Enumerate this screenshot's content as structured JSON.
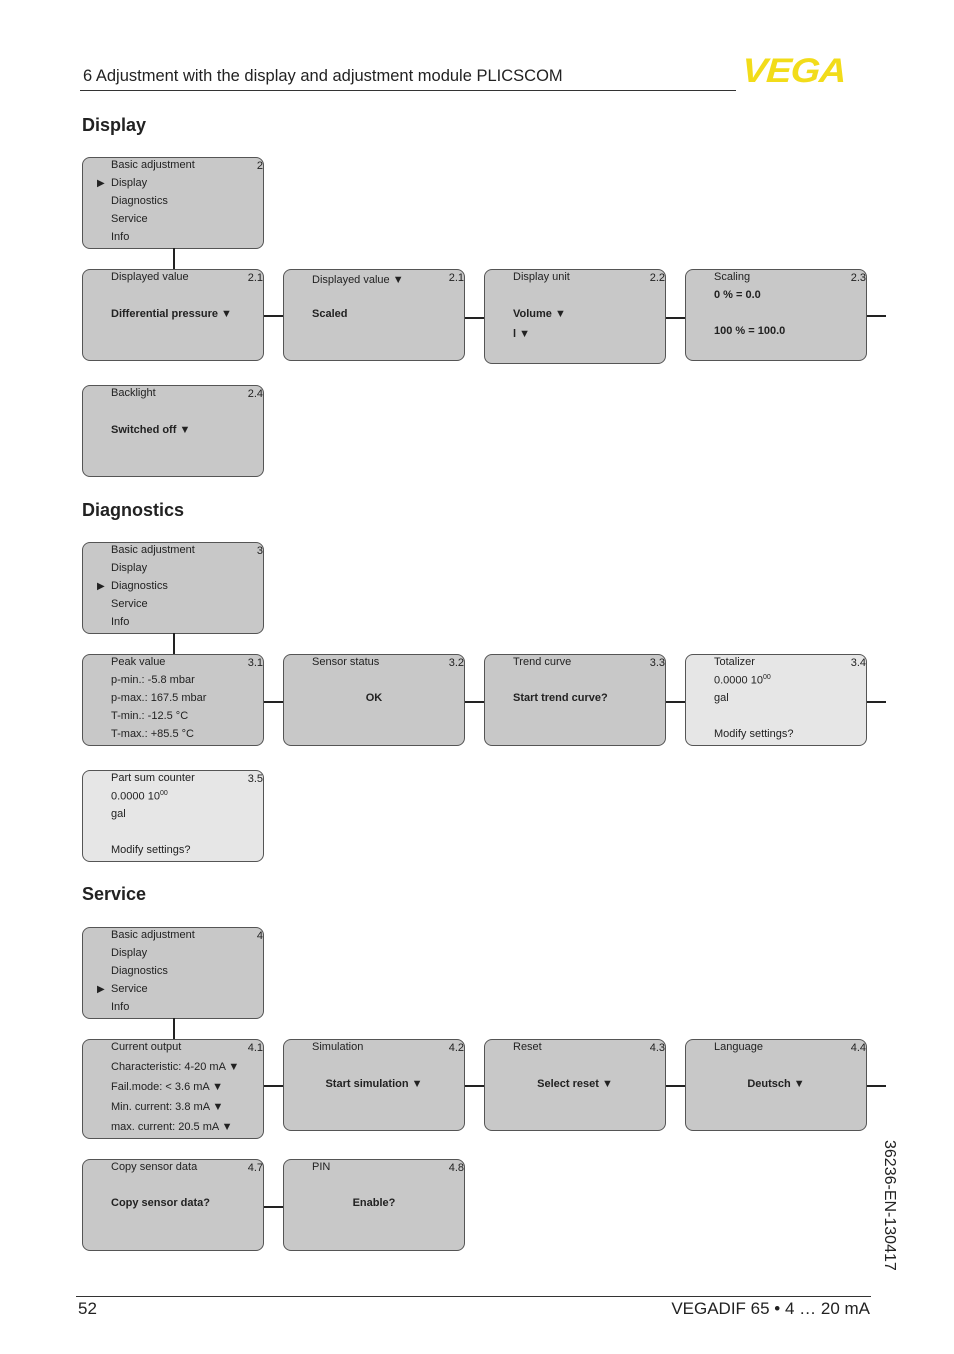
{
  "header": {
    "title": "6 Adjustment with the display and adjustment module PLICSCOM",
    "logo": "VEGA",
    "logo_color": "#f2dc1a"
  },
  "sections": {
    "display": "Display",
    "diagnostics": "Diagnostics",
    "service": "Service"
  },
  "menu": {
    "items": [
      "Basic adjustment",
      "Display",
      "Diagnostics",
      "Service",
      "Info"
    ],
    "pointer": "▶"
  },
  "display": {
    "menu_num": "2",
    "displayed_value": {
      "title": "Displayed value",
      "num": "2.1",
      "value": "Differential pressure ▼"
    },
    "displayed_value_scaled": {
      "title": "Displayed value ▼",
      "num": "2.1",
      "value": "Scaled"
    },
    "display_unit": {
      "title": "Display unit",
      "num": "2.2",
      "value1": "Volume ▼",
      "value2": "l ▼"
    },
    "scaling": {
      "title": "Scaling",
      "num": "2.3",
      "value1": "0 % = 0.0",
      "value2": "100 % = 100.0"
    },
    "backlight": {
      "title": "Backlight",
      "num": "2.4",
      "value": "Switched off ▼"
    }
  },
  "diagnostics": {
    "menu_num": "3",
    "peak": {
      "title": "Peak value",
      "num": "3.1",
      "lines": [
        "p-min.: -5.8 mbar",
        "p-max.: 167.5 mbar",
        "T-min.: -12.5 °C",
        "T-max.: +85.5 °C"
      ]
    },
    "sensor_status": {
      "title": "Sensor status",
      "num": "3.2",
      "value": "OK"
    },
    "trend": {
      "title": "Trend curve",
      "num": "3.3",
      "value": "Start trend curve?"
    },
    "totalizer": {
      "title": "Totalizer",
      "num": "3.4",
      "value": "0.0000 10",
      "exp": "00",
      "unit": "gal",
      "action": "Modify settings?"
    },
    "part_sum": {
      "title": "Part sum counter",
      "num": "3.5",
      "value": "0.0000 10",
      "exp": "00",
      "unit": "gal",
      "action": "Modify settings?"
    }
  },
  "service": {
    "menu_num": "4",
    "current_output": {
      "title": "Current output",
      "num": "4.1",
      "lines": [
        "Characteristic: 4-20 mA ▼",
        "Fail.mode: < 3.6 mA ▼",
        "Min. current: 3.8 mA ▼",
        "max. current: 20.5 mA ▼"
      ]
    },
    "simulation": {
      "title": "Simulation",
      "num": "4.2",
      "value": "Start simulation ▼"
    },
    "reset": {
      "title": "Reset",
      "num": "4.3",
      "value": "Select reset ▼"
    },
    "language": {
      "title": "Language",
      "num": "4.4",
      "value": "Deutsch ▼"
    },
    "copy": {
      "title": "Copy sensor data",
      "num": "4.7",
      "value": "Copy sensor data?"
    },
    "pin": {
      "title": "PIN",
      "num": "4.8",
      "value": "Enable?"
    }
  },
  "footer": {
    "page": "52",
    "product": "VEGADIF 65 • 4 … 20 mA",
    "doc_id": "36236-EN-130417"
  }
}
